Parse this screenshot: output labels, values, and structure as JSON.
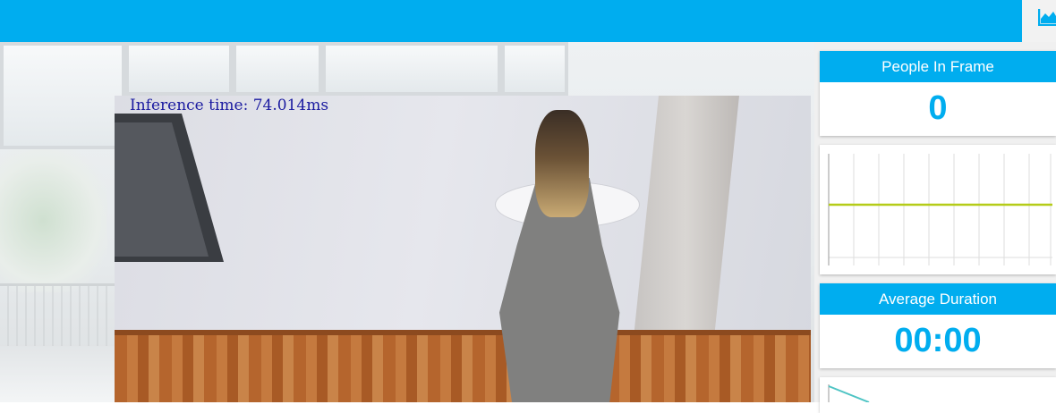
{
  "header": {
    "tab_icon": "area-chart-icon"
  },
  "video": {
    "overlay_text": "Inference time: 74.014ms"
  },
  "people_card": {
    "title": "People In Frame",
    "value": "0"
  },
  "people_chart": {
    "line_color": "#b5cc18"
  },
  "duration_card": {
    "title": "Average Duration",
    "value": "00:00"
  },
  "colors": {
    "accent": "#00adef",
    "overlay_text": "#1a1aa0"
  }
}
